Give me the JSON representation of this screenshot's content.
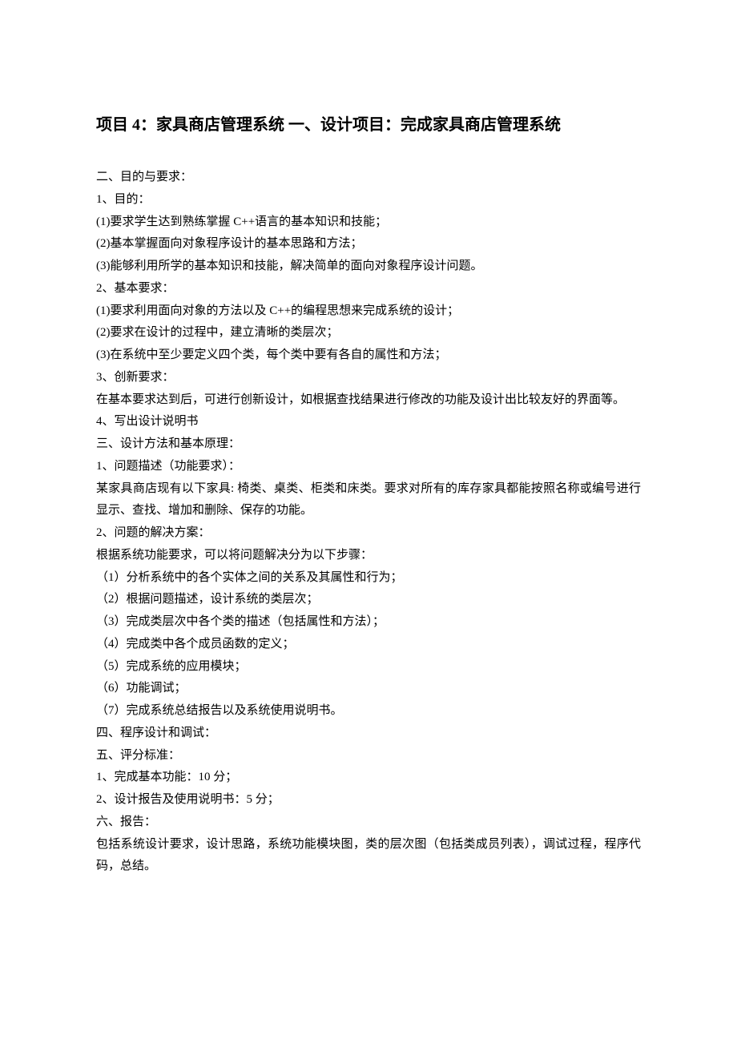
{
  "heading": "项目 4：家具商店管理系统  一、设计项目：完成家具商店管理系统",
  "lines": [
    "二、目的与要求：",
    "1、目的：",
    "(1)要求学生达到熟练掌握 C++语言的基本知识和技能；",
    "(2)基本掌握面向对象程序设计的基本思路和方法；",
    "(3)能够利用所学的基本知识和技能，解决简单的面向对象程序设计问题。",
    "2、基本要求：",
    "(1)要求利用面向对象的方法以及 C++的编程思想来完成系统的设计；",
    "(2)要求在设计的过程中，建立清晰的类层次；",
    "(3)在系统中至少要定义四个类，每个类中要有各自的属性和方法；",
    "3、创新要求：",
    "在基本要求达到后，可进行创新设计，如根据查找结果进行修改的功能及设计出比较友好的界面等。",
    "4、写出设计说明书",
    "三、设计方法和基本原理：",
    "1、问题描述（功能要求）：",
    "某家具商店现有以下家具: 椅类、桌类、柜类和床类。要求对所有的库存家具都能按照名称或编号进行显示、查找、增加和删除、保存的功能。",
    "2、问题的解决方案：",
    "根据系统功能要求，可以将问题解决分为以下步骤：",
    "（1）分析系统中的各个实体之间的关系及其属性和行为；",
    "（2）根据问题描述，设计系统的类层次；",
    "（3）完成类层次中各个类的描述（包括属性和方法）；",
    "（4）完成类中各个成员函数的定义；",
    "（5）完成系统的应用模块；",
    "（6）功能调试；",
    "（7）完成系统总结报告以及系统使用说明书。",
    "四、程序设计和调试：",
    "五、评分标准：",
    "1、完成基本功能：10 分；",
    "2、设计报告及使用说明书：5 分；",
    "六、报告：",
    "包括系统设计要求，设计思路，系统功能模块图，类的层次图（包括类成员列表），调试过程，程序代码，总结。"
  ]
}
